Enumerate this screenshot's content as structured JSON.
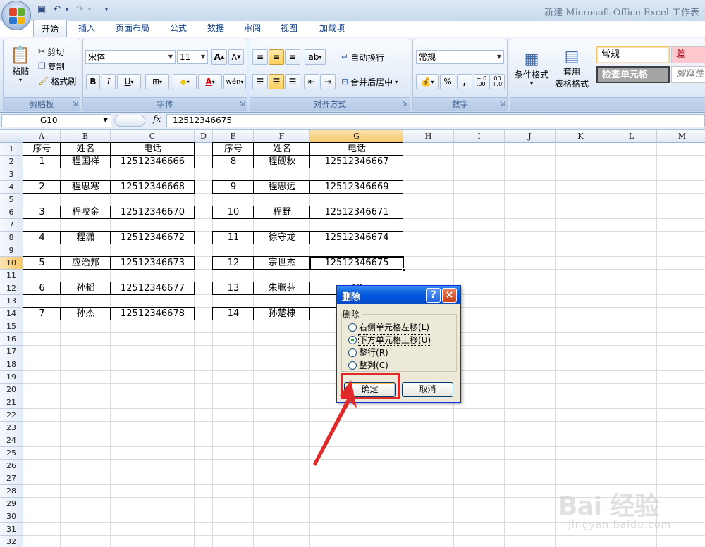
{
  "window": {
    "title": "新建 Microsoft Office Excel 工作表"
  },
  "ribbon": {
    "tabs": [
      "开始",
      "插入",
      "页面布局",
      "公式",
      "数据",
      "审阅",
      "视图",
      "加载项"
    ],
    "clipboard": {
      "paste": "粘贴",
      "cut": "剪切",
      "copy": "复制",
      "format_painter": "格式刷",
      "label": "剪贴板"
    },
    "font": {
      "name": "宋体",
      "size": "11",
      "label": "字体",
      "bold": "B",
      "italic": "I",
      "underline": "U",
      "grow": "A",
      "shrink": "A",
      "phonetic": "wén"
    },
    "alignment": {
      "wrap_text": "自动换行",
      "merge_center": "合并后居中",
      "label": "对齐方式"
    },
    "number": {
      "format": "常规",
      "label": "数字",
      "percent": "%",
      "comma": ",",
      "inc_dec": "+.0\n.00",
      "dec_dec": ".00\n+.0"
    },
    "styles": {
      "conditional_format": "条件格式",
      "format_as_table_1": "套用",
      "format_as_table_2": "表格格式",
      "normal": "常规",
      "bad": "差",
      "check_cell": "检查单元格",
      "explanatory": "解释性"
    }
  },
  "formula_bar": {
    "name_box": "G10",
    "fx": "fx",
    "value": "12512346675"
  },
  "grid": {
    "columns": [
      "A",
      "B",
      "C",
      "D",
      "E",
      "F",
      "G",
      "H",
      "I",
      "J",
      "K",
      "L",
      "M"
    ],
    "rows": [
      "1",
      "2",
      "3",
      "4",
      "5",
      "6",
      "7",
      "8",
      "9",
      "10",
      "11",
      "12",
      "13",
      "14",
      "15",
      "16",
      "17",
      "18",
      "19",
      "20",
      "21",
      "22",
      "23",
      "24",
      "25",
      "26",
      "27",
      "28",
      "29",
      "30",
      "31",
      "32"
    ],
    "selected_column": "G",
    "selected_row": "10",
    "table_left": {
      "headers": [
        "序号",
        "姓名",
        "电话"
      ],
      "rows": [
        {
          "num": "1",
          "name": "程国祥",
          "phone": "12512346666"
        },
        {
          "num": "2",
          "name": "程思寒",
          "phone": "12512346668"
        },
        {
          "num": "3",
          "name": "程咬金",
          "phone": "12512346670"
        },
        {
          "num": "4",
          "name": "程潇",
          "phone": "12512346672"
        },
        {
          "num": "5",
          "name": "应治邦",
          "phone": "12512346673"
        },
        {
          "num": "6",
          "name": "孙韬",
          "phone": "12512346677"
        },
        {
          "num": "7",
          "name": "孙杰",
          "phone": "12512346678"
        }
      ]
    },
    "table_right": {
      "headers": [
        "序号",
        "姓名",
        "电话"
      ],
      "rows": [
        {
          "num": "8",
          "name": "程砚秋",
          "phone": "12512346667"
        },
        {
          "num": "9",
          "name": "程思远",
          "phone": "12512346669"
        },
        {
          "num": "10",
          "name": "程野",
          "phone": "12512346671"
        },
        {
          "num": "11",
          "name": "徐守龙",
          "phone": "12512346674"
        },
        {
          "num": "12",
          "name": "宗世杰",
          "phone": "12512346675"
        },
        {
          "num": "13",
          "name": "朱腾芬",
          "phone": "12"
        },
        {
          "num": "14",
          "name": "孙楚棣",
          "phone": "12"
        }
      ]
    }
  },
  "dialog": {
    "title": "删除",
    "help": "?",
    "close": "×",
    "group": "删除",
    "options": [
      {
        "label": "右侧单元格左移",
        "key": "(L)",
        "selected": false
      },
      {
        "label": "下方单元格上移",
        "key": "(U)",
        "selected": true
      },
      {
        "label": "整行",
        "key": "(R)",
        "selected": false
      },
      {
        "label": "整列",
        "key": "(C)",
        "selected": false
      }
    ],
    "ok": "确定",
    "cancel": "取消"
  },
  "annotation": {
    "highlight_color": "#e02a2a"
  },
  "watermark": {
    "brand": "Bai 经验",
    "site": "jingyan.baidu.com"
  },
  "colors": {
    "ribbon": "#dde8f6",
    "selection": "#f7c867",
    "dialog_title": "#0054e3"
  }
}
